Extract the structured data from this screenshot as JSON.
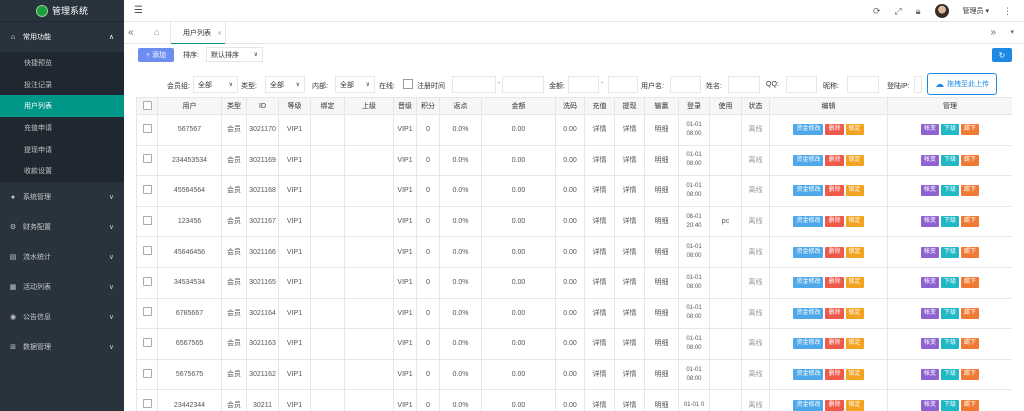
{
  "app": {
    "title": "管理系统"
  },
  "sidebar": {
    "groups": [
      {
        "label": "常用功能",
        "icon": "home-icon",
        "open": true,
        "items": [
          {
            "label": "快捷预览",
            "active": false
          },
          {
            "label": "投注记录",
            "active": false
          },
          {
            "label": "用户列表",
            "active": true
          },
          {
            "label": "充值申请",
            "active": false
          },
          {
            "label": "提现申请",
            "active": false
          },
          {
            "label": "收款设置",
            "active": false
          }
        ]
      },
      {
        "label": "系统管理",
        "icon": "dot-icon"
      },
      {
        "label": "财务配置",
        "icon": "gear-icon"
      },
      {
        "label": "流水统计",
        "icon": "chart-icon"
      },
      {
        "label": "活动列表",
        "icon": "list-icon"
      },
      {
        "label": "公告信息",
        "icon": "bell-icon"
      },
      {
        "label": "数据管理",
        "icon": "data-icon"
      }
    ]
  },
  "header": {
    "user_name": "管理员"
  },
  "tabs": [
    {
      "label": "用户列表"
    }
  ],
  "toolbar": {
    "add_label": "添加",
    "sort_label": "排序:",
    "sort_value": "默认排序"
  },
  "filters": {
    "group_label": "会员组:",
    "group_value": "全部",
    "type_label": "类型:",
    "type_value": "全部",
    "internal_label": "内部:",
    "internal_value": "全部",
    "online_label": "在线:",
    "regtime_label": "注册时间",
    "amount_label": "金额:",
    "username_label": "用户名:",
    "name_label": "姓名:",
    "qq_label": "QQ:",
    "nickname_label": "昵称:",
    "loginip_label": "登陆IP:",
    "upload_label": "拖拽至此上传"
  },
  "table": {
    "headers": [
      "用户",
      "类型",
      "ID",
      "等级",
      "绑定",
      "上级",
      "晋级",
      "积分",
      "返点",
      "金额",
      "洗码",
      "充值",
      "提现",
      "输赢",
      "登录",
      "使用",
      "状态",
      "编辑",
      "管理"
    ],
    "edit_buttons": {
      "fund": "资金修改",
      "delete": "删除",
      "lock": "锁定"
    },
    "manage_buttons": {
      "account": "帐变",
      "downline": "下级",
      "kick": "踢下"
    },
    "rows": [
      {
        "user": "567567",
        "type": "会员",
        "id": "3021170",
        "level": "VIP1",
        "bind": "",
        "parent": "",
        "promo": "VIP1",
        "points": "0",
        "rebate": "0.0%",
        "amount": "0.00",
        "wash": "0.00",
        "deposit": "详情",
        "withdraw": "详情",
        "winloss": "明细",
        "login": "01-01 08:00",
        "use": "",
        "status": "离线"
      },
      {
        "user": "234453534",
        "type": "会员",
        "id": "3021169",
        "level": "VIP1",
        "bind": "",
        "parent": "",
        "promo": "VIP1",
        "points": "0",
        "rebate": "0.0%",
        "amount": "0.00",
        "wash": "0.00",
        "deposit": "详情",
        "withdraw": "详情",
        "winloss": "明细",
        "login": "01-01 08:00",
        "use": "",
        "status": "离线"
      },
      {
        "user": "45564564",
        "type": "会员",
        "id": "3021168",
        "level": "VIP1",
        "bind": "",
        "parent": "",
        "promo": "VIP1",
        "points": "0",
        "rebate": "0.0%",
        "amount": "0.00",
        "wash": "0.00",
        "deposit": "详情",
        "withdraw": "详情",
        "winloss": "明细",
        "login": "01-01 08:00",
        "use": "",
        "status": "离线"
      },
      {
        "user": "123456",
        "type": "会员",
        "id": "3021167",
        "level": "VIP1",
        "bind": "",
        "parent": "",
        "promo": "VIP1",
        "points": "0",
        "rebate": "0.0%",
        "amount": "0.00",
        "wash": "0.00",
        "deposit": "详情",
        "withdraw": "详情",
        "winloss": "明细",
        "login": "08-01 20:40",
        "use": "pc",
        "status": "离线"
      },
      {
        "user": "45646456",
        "type": "会员",
        "id": "3021166",
        "level": "VIP1",
        "bind": "",
        "parent": "",
        "promo": "VIP1",
        "points": "0",
        "rebate": "0.0%",
        "amount": "0.00",
        "wash": "0.00",
        "deposit": "详情",
        "withdraw": "详情",
        "winloss": "明细",
        "login": "01-01 08:00",
        "use": "",
        "status": "离线"
      },
      {
        "user": "34534534",
        "type": "会员",
        "id": "3021165",
        "level": "VIP1",
        "bind": "",
        "parent": "",
        "promo": "VIP1",
        "points": "0",
        "rebate": "0.0%",
        "amount": "0.00",
        "wash": "0.00",
        "deposit": "详情",
        "withdraw": "详情",
        "winloss": "明细",
        "login": "01-01 08:00",
        "use": "",
        "status": "离线"
      },
      {
        "user": "6785667",
        "type": "会员",
        "id": "3021164",
        "level": "VIP1",
        "bind": "",
        "parent": "",
        "promo": "VIP1",
        "points": "0",
        "rebate": "0.0%",
        "amount": "0.00",
        "wash": "0.00",
        "deposit": "详情",
        "withdraw": "详情",
        "winloss": "明细",
        "login": "01-01 08:00",
        "use": "",
        "status": "离线"
      },
      {
        "user": "6567565",
        "type": "会员",
        "id": "3021163",
        "level": "VIP1",
        "bind": "",
        "parent": "",
        "promo": "VIP1",
        "points": "0",
        "rebate": "0.0%",
        "amount": "0.00",
        "wash": "0.00",
        "deposit": "详情",
        "withdraw": "详情",
        "winloss": "明细",
        "login": "01-01 08:00",
        "use": "",
        "status": "离线"
      },
      {
        "user": "5675675",
        "type": "会员",
        "id": "3021162",
        "level": "VIP1",
        "bind": "",
        "parent": "",
        "promo": "VIP1",
        "points": "0",
        "rebate": "0.0%",
        "amount": "0.00",
        "wash": "0.00",
        "deposit": "详情",
        "withdraw": "详情",
        "winloss": "明细",
        "login": "01-01 08:00",
        "use": "",
        "status": "离线"
      },
      {
        "user": "23442344",
        "type": "会员",
        "id": "30211",
        "level": "VIP1",
        "bind": "",
        "parent": "",
        "promo": "VIP1",
        "points": "0",
        "rebate": "0.0%",
        "amount": "0.00",
        "wash": "0.00",
        "deposit": "详情",
        "withdraw": "详情",
        "winloss": "明细",
        "login": "01-01 0",
        "use": "",
        "status": "离线"
      }
    ]
  },
  "colors": {
    "sidebar_bg": "#28333e",
    "active_green": "#009688",
    "primary_blue": "#1e88e5",
    "add_blue": "#6c8ef0"
  }
}
